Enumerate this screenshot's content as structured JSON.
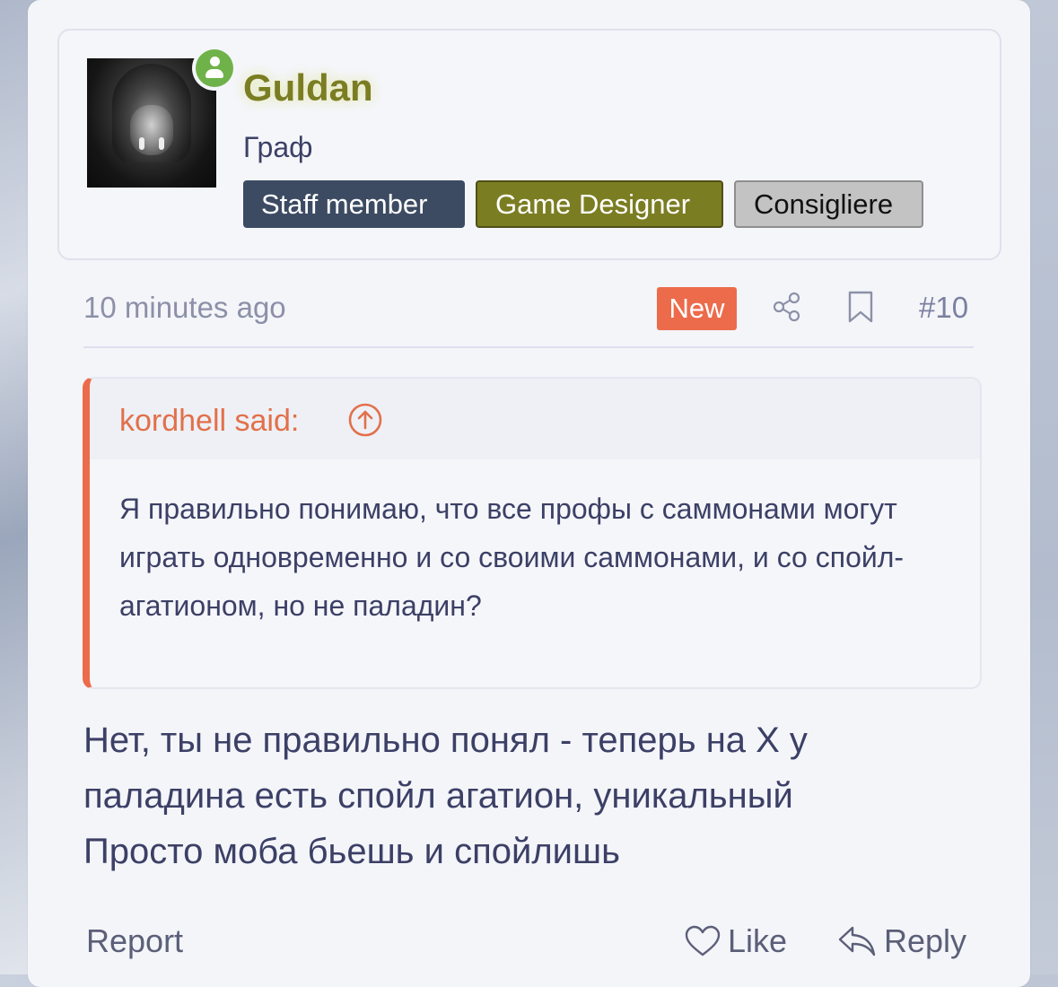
{
  "author": {
    "username": "Guldan",
    "user_title": "Граф",
    "online_status": "online",
    "username_color": "#7b7d22",
    "banners": [
      {
        "label": "Staff member",
        "color": "#3c4b62"
      },
      {
        "label": "Game Designer",
        "color": "#7b7d22"
      },
      {
        "label": "Consigliere",
        "color": "#c3c3c3"
      }
    ]
  },
  "meta": {
    "time": "10 minutes ago",
    "new_label": "New",
    "post_number": "#10",
    "accent_color": "#ec6b4b"
  },
  "quote": {
    "author_label": "kordhell said:",
    "text": "Я правильно понимаю, что все профы с саммонами могут играть одновременно и со своими саммонами, и со спойл-агатионом, но не паладин?"
  },
  "message": {
    "lines": [
      "Нет, ты не правильно понял - теперь на Х у",
      "паладина есть спойл агатион, уникальный",
      "Просто моба бьешь и спойлишь"
    ]
  },
  "actions": {
    "report": "Report",
    "like": "Like",
    "reply": "Reply"
  },
  "icons": [
    "online-user-icon",
    "share-icon",
    "bookmark-icon",
    "arrow-up-circle-icon",
    "heart-icon",
    "reply-icon"
  ]
}
